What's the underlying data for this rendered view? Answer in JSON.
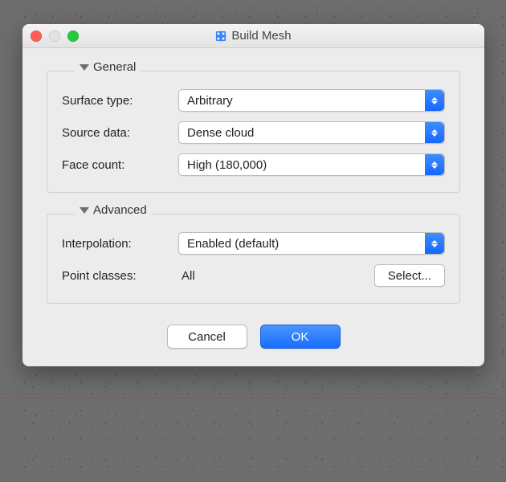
{
  "window": {
    "title": "Build Mesh"
  },
  "groups": {
    "general": {
      "title": "General",
      "surface_type": {
        "label": "Surface type:",
        "value": "Arbitrary"
      },
      "source_data": {
        "label": "Source data:",
        "value": "Dense cloud"
      },
      "face_count": {
        "label": "Face count:",
        "value": "High (180,000)"
      }
    },
    "advanced": {
      "title": "Advanced",
      "interpolation": {
        "label": "Interpolation:",
        "value": "Enabled (default)"
      },
      "point_classes": {
        "label": "Point classes:",
        "value": "All",
        "button": "Select..."
      }
    }
  },
  "buttons": {
    "cancel": "Cancel",
    "ok": "OK"
  }
}
